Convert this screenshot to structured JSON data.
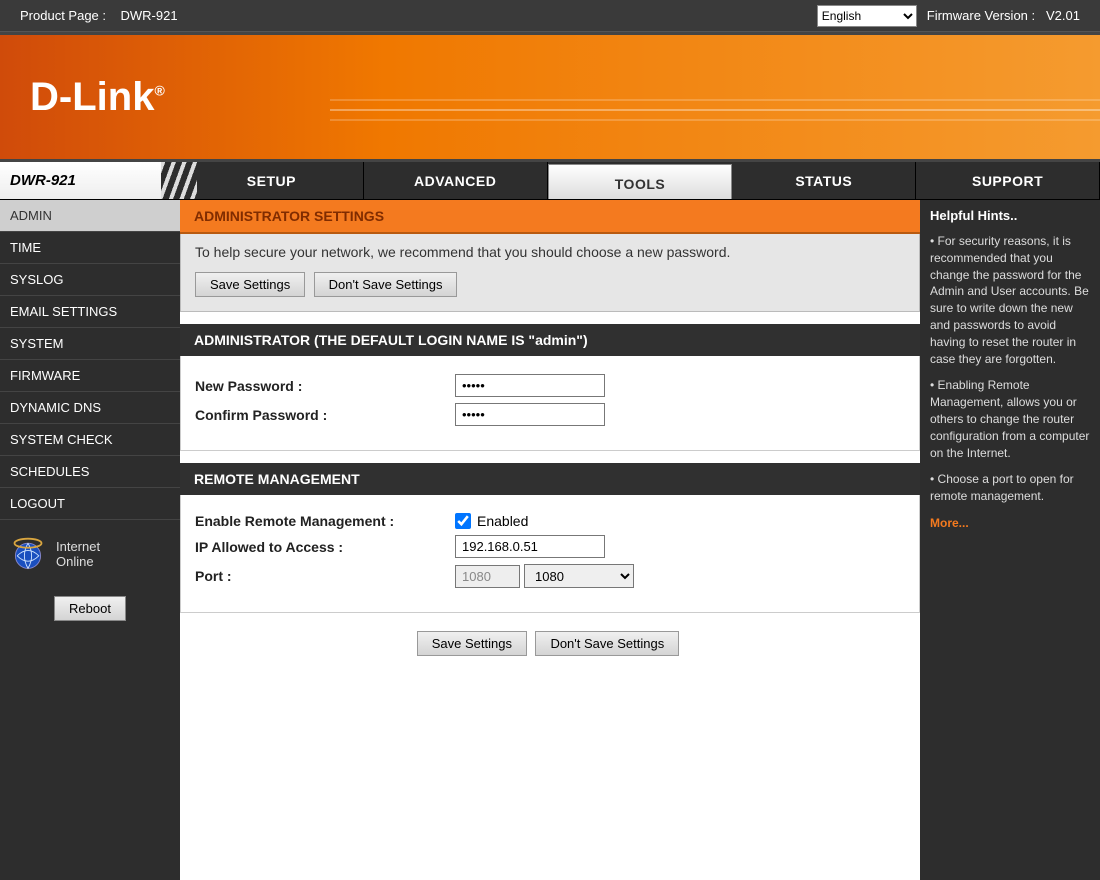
{
  "topbar": {
    "product_page_label": "Product Page :",
    "product_page_value": "DWR-921",
    "language_selected": "English",
    "firmware_label": "Firmware Version :",
    "firmware_value": "V2.01"
  },
  "brand": "D-Link",
  "device_model": "DWR-921",
  "tabs": {
    "setup": "SETUP",
    "advanced": "ADVANCED",
    "tools": "TOOLS",
    "status": "STATUS",
    "support": "SUPPORT"
  },
  "sidebar": {
    "items": [
      {
        "label": "ADMIN",
        "active": true
      },
      {
        "label": "TIME"
      },
      {
        "label": "SYSLOG"
      },
      {
        "label": "EMAIL SETTINGS"
      },
      {
        "label": "SYSTEM"
      },
      {
        "label": "FIRMWARE"
      },
      {
        "label": "DYNAMIC DNS"
      },
      {
        "label": "SYSTEM CHECK"
      },
      {
        "label": "SCHEDULES"
      },
      {
        "label": "LOGOUT"
      }
    ],
    "internet_label_line1": "Internet",
    "internet_label_line2": "Online",
    "reboot_label": "Reboot"
  },
  "content": {
    "title": "ADMINISTRATOR SETTINGS",
    "intro": "To help secure your network, we recommend that you should choose a new password.",
    "save_button": "Save Settings",
    "dont_save_button": "Don't Save Settings",
    "admin_header": "ADMINISTRATOR (THE DEFAULT LOGIN NAME IS \"admin\")",
    "new_password_label": "New Password :",
    "new_password_value": "•••••",
    "confirm_password_label": "Confirm Password :",
    "confirm_password_value": "•••••",
    "remote_header": "REMOTE MANAGEMENT",
    "enable_remote_label": "Enable Remote Management :",
    "enabled_text": "Enabled",
    "enabled_checked": true,
    "ip_allowed_label": "IP Allowed to Access :",
    "ip_allowed_value": "192.168.0.51",
    "port_label": "Port :",
    "port_text_value": "1080",
    "port_select_value": "1080"
  },
  "hints": {
    "title": "Helpful Hints..",
    "p1": "For security reasons, it is recommended that you change the password for the Admin and User accounts. Be sure to write down the new and passwords to avoid having to reset the router in case they are forgotten.",
    "p2": "Enabling Remote Management, allows you or others to change the router configuration from a computer on the Internet.",
    "p3": "Choose a port to open for remote management.",
    "more": "More..."
  }
}
